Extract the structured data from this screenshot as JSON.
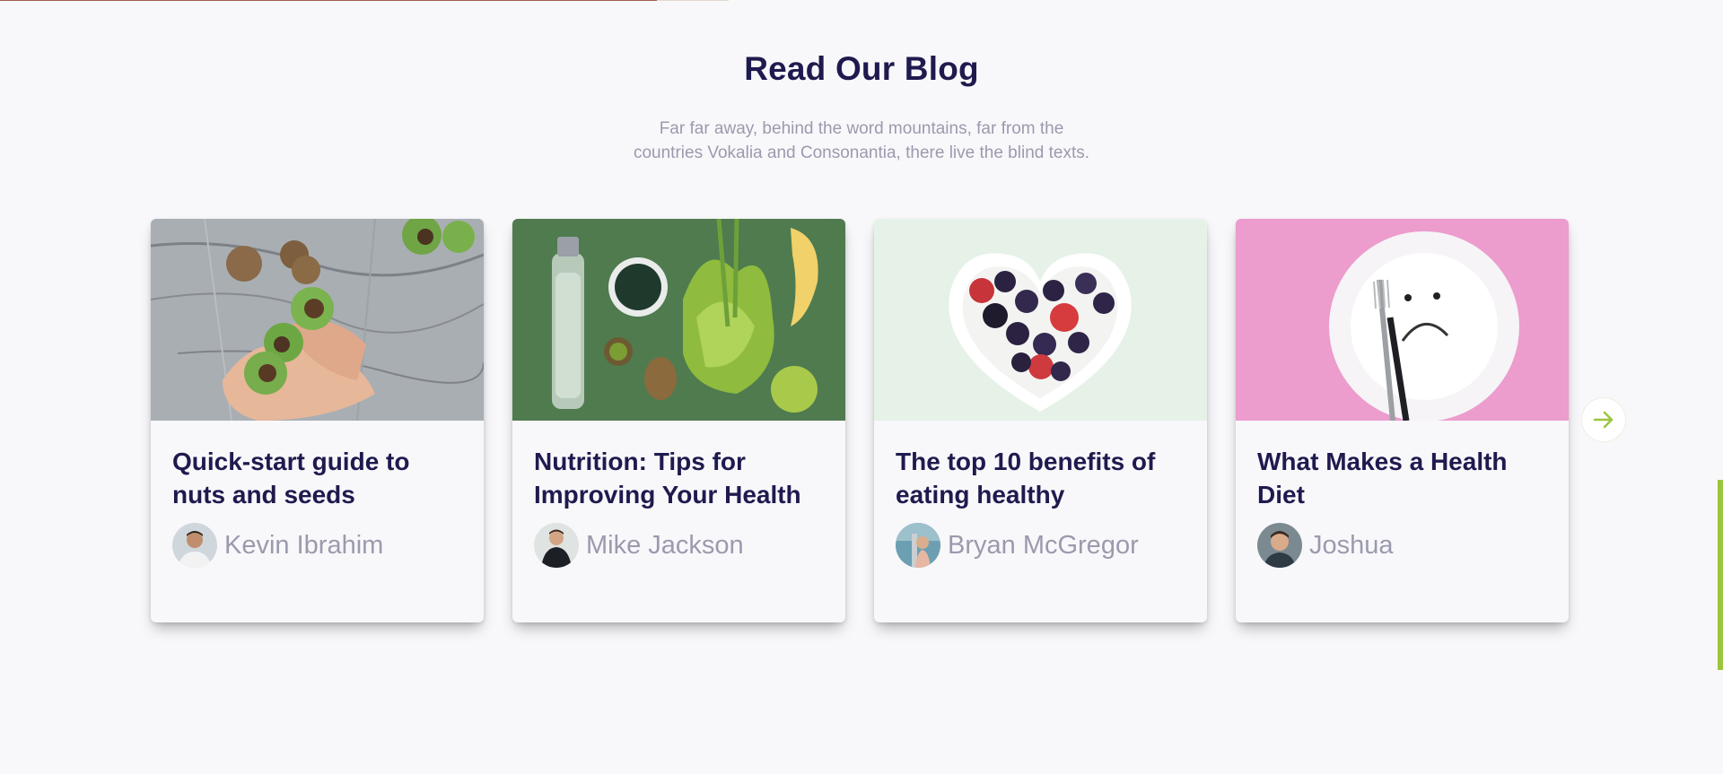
{
  "section": {
    "title": "Read Our Blog",
    "subtitle": "Far far away, behind the word mountains, far from the countries Vokalia and Consonantia, there live the blind texts."
  },
  "posts": [
    {
      "title": "Quick-start guide to nuts and seeds",
      "author": "Kevin Ibrahim",
      "image": "hands-holding-walnuts-photo"
    },
    {
      "title": "Nutrition: Tips for Improving Your Health",
      "author": "Mike Jackson",
      "image": "water-bottle-greens-fruit-photo"
    },
    {
      "title": "The top 10 benefits of eating healthy",
      "author": "Bryan McGregor",
      "image": "heart-bowl-berries-photo"
    },
    {
      "title": "What Makes a Health Diet",
      "author": "Joshua",
      "image": "sad-face-plate-fork-photo"
    }
  ],
  "carousel": {
    "next_icon": "arrow-right-icon"
  },
  "colors": {
    "heading": "#1f1a4e",
    "muted_text": "#9b9aad",
    "accent": "#9bc53d",
    "background": "#f8f8fb"
  }
}
